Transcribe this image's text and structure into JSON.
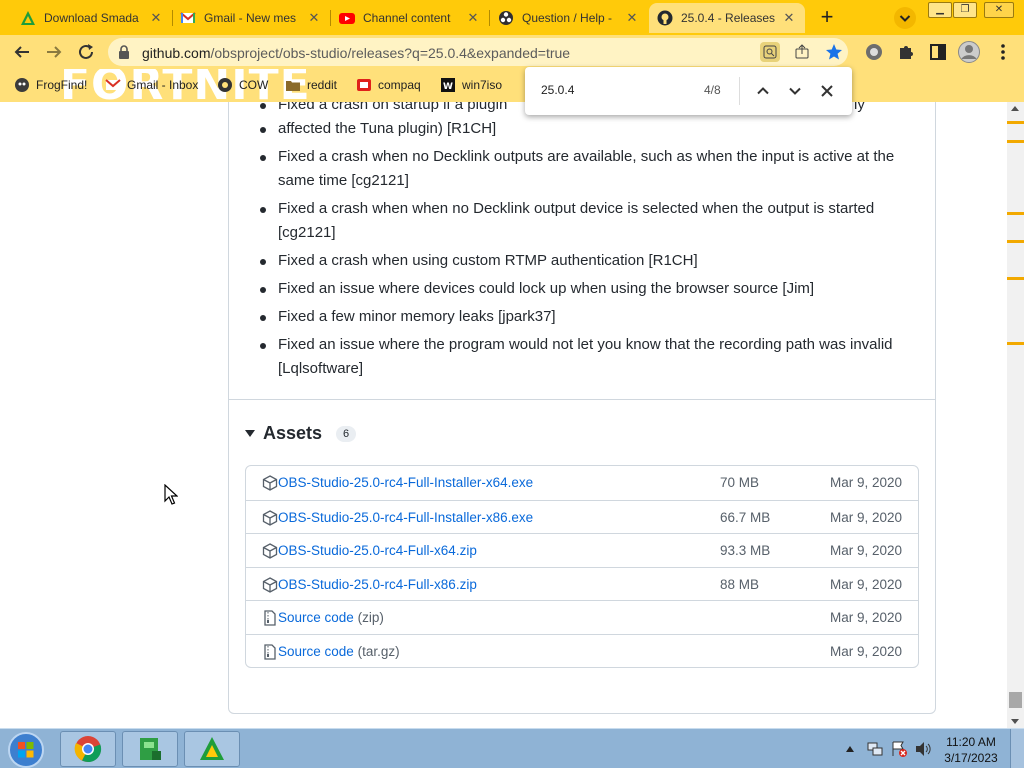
{
  "browser": {
    "tabs": [
      {
        "title": "Download Smada",
        "favicon": "smadav-icon"
      },
      {
        "title": "Gmail - New mes",
        "favicon": "gmail-icon"
      },
      {
        "title": "Channel content",
        "favicon": "youtube-icon"
      },
      {
        "title": "Question / Help -",
        "favicon": "obs-icon"
      },
      {
        "title": "25.0.4 - Releases",
        "favicon": "github-icon",
        "active": true
      }
    ],
    "address": {
      "host": "github.com",
      "path": "/obsproject/obs-studio/releases?q=25.0.4&expanded=true"
    },
    "bookmarks": [
      {
        "label": "FrogFind!",
        "icon": "frog-icon"
      },
      {
        "label": "Gmail - Inbox",
        "icon": "gmail-icon"
      },
      {
        "label": "COW",
        "icon": "globe-icon"
      },
      {
        "label": "reddit",
        "icon": "folder-icon"
      },
      {
        "label": "compaq",
        "icon": "compaq-icon"
      },
      {
        "label": "win7iso",
        "icon": "win-icon"
      }
    ],
    "theme_text": "FORTNITE",
    "theme_color": "#ffca0a"
  },
  "findbar": {
    "query": "25.0.4",
    "count": "4/8"
  },
  "release": {
    "notes": [
      {
        "text": "Fixed a crash on startup if a plugin",
        "tail": "ly"
      },
      {
        "text": "affected the Tuna plugin) [R1CH]"
      },
      {
        "text": "Fixed a crash when no Decklink outputs are available, such as when the input is active at the same time [cg2121]"
      },
      {
        "text": "Fixed a crash when when no Decklink output device is selected when the output is started [cg2121]"
      },
      {
        "text": "Fixed a crash when using custom RTMP authentication [R1CH]"
      },
      {
        "text": "Fixed an issue where devices could lock up when using the browser source [Jim]"
      },
      {
        "text": "Fixed a few minor memory leaks [jpark37]"
      },
      {
        "text": "Fixed an issue where the program would not let you know that the recording path was invalid [Lqlsoftware]"
      }
    ],
    "assets_title": "Assets",
    "assets_count": "6",
    "assets": [
      {
        "name": "OBS-Studio-25.0-rc4-Full-Installer-x64.exe",
        "ext": "",
        "size": "70 MB",
        "date": "Mar 9, 2020",
        "icon": "package-icon"
      },
      {
        "name": "OBS-Studio-25.0-rc4-Full-Installer-x86.exe",
        "ext": "",
        "size": "66.7 MB",
        "date": "Mar 9, 2020",
        "icon": "package-icon"
      },
      {
        "name": "OBS-Studio-25.0-rc4-Full-x64.zip",
        "ext": "",
        "size": "93.3 MB",
        "date": "Mar 9, 2020",
        "icon": "package-icon"
      },
      {
        "name": "OBS-Studio-25.0-rc4-Full-x86.zip",
        "ext": "",
        "size": "88 MB",
        "date": "Mar 9, 2020",
        "icon": "package-icon"
      },
      {
        "name": "Source code",
        "ext": "(zip)",
        "size": "",
        "date": "Mar 9, 2020",
        "icon": "file-zip-icon"
      },
      {
        "name": "Source code",
        "ext": "(tar.gz)",
        "size": "",
        "date": "Mar 9, 2020",
        "icon": "file-zip-icon"
      }
    ]
  },
  "taskbar": {
    "time": "11:20 AM",
    "date": "3/17/2023"
  }
}
